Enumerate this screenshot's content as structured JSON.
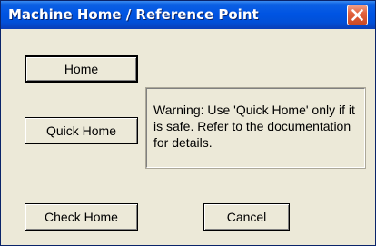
{
  "window": {
    "title": "Machine Home / Reference Point"
  },
  "buttons": {
    "home": "Home",
    "quick_home": "Quick Home",
    "check_home": "Check Home",
    "cancel": "Cancel"
  },
  "warning": {
    "text": "Warning: Use 'Quick Home' only if it is safe.  Refer to the documentation for details."
  },
  "icons": {
    "close": "close-icon"
  },
  "colors": {
    "titlebar": "#0054e3",
    "dialog_background": "#ece9d8",
    "close_button": "#e2623d"
  }
}
